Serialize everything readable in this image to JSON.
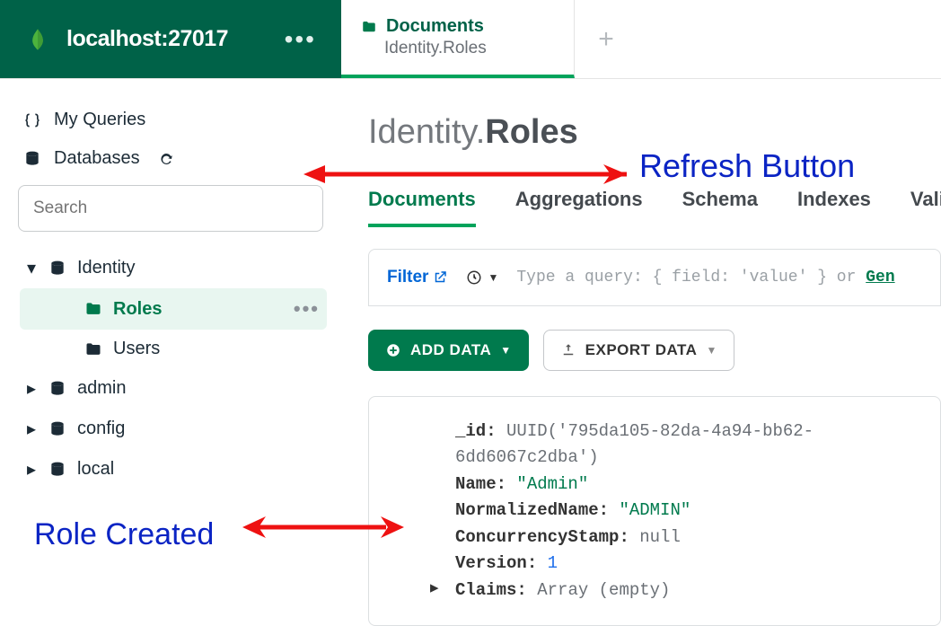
{
  "header": {
    "connection_title": "localhost:27017",
    "tab": {
      "title": "Documents",
      "subtitle": "Identity.Roles"
    }
  },
  "sidebar": {
    "my_queries_label": "My Queries",
    "databases_label": "Databases",
    "search_placeholder": "Search",
    "tree": {
      "identity": {
        "label": "Identity",
        "roles_label": "Roles",
        "users_label": "Users"
      },
      "admin_label": "admin",
      "config_label": "config",
      "local_label": "local"
    }
  },
  "main": {
    "breadcrumb_db": "Identity.",
    "breadcrumb_coll": "Roles",
    "subtabs": {
      "documents": "Documents",
      "aggregations": "Aggregations",
      "schema": "Schema",
      "indexes": "Indexes",
      "validation": "Valid"
    },
    "filter": {
      "label": "Filter",
      "placeholder_prefix": "Type a query: { field: 'value' } or ",
      "placeholder_link": "Gen"
    },
    "buttons": {
      "add_data": "ADD DATA",
      "export_data": "EXPORT DATA"
    },
    "document": {
      "fields": {
        "id_key": "_id",
        "id_value": "UUID('795da105-82da-4a94-bb62-6dd6067c2dba')",
        "name_key": "Name",
        "name_value": "\"Admin\"",
        "norm_key": "NormalizedName",
        "norm_value": "\"ADMIN\"",
        "cs_key": "ConcurrencyStamp",
        "cs_value": "null",
        "ver_key": "Version",
        "ver_value": "1",
        "claims_key": "Claims",
        "claims_value": "Array (empty)"
      }
    }
  },
  "annotations": {
    "refresh": "Refresh Button",
    "role_created": "Role Created"
  }
}
